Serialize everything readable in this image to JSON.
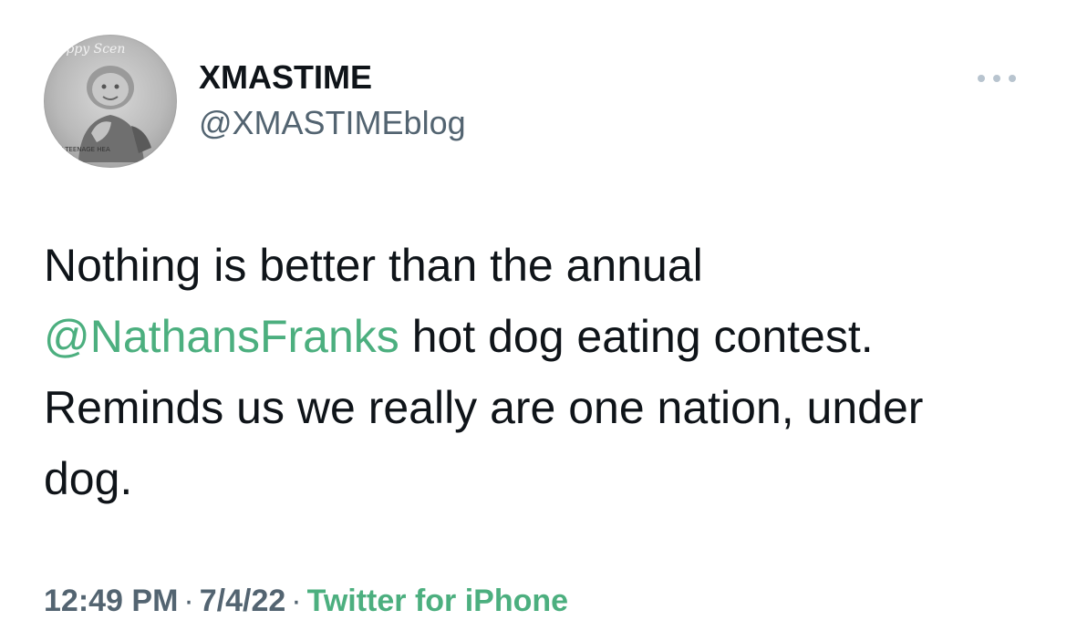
{
  "author": {
    "name": "XMASTIME",
    "handle": "@XMASTIMEblog",
    "avatar_text_top": "appy Scen",
    "avatar_text_bottom": "E MY TEENAGE HEA"
  },
  "tweet": {
    "text_before": "Nothing is better than the annual ",
    "mention": "@NathansFranks",
    "text_after": " hot dog eating contest. Reminds us we really are one nation, under dog."
  },
  "meta": {
    "time": "12:49 PM",
    "separator": "·",
    "date": "7/4/22",
    "source": "Twitter for iPhone"
  },
  "icons": {
    "more": "more-horizontal-icon"
  },
  "colors": {
    "text": "#0f1419",
    "secondary": "#536471",
    "link": "#4caf7f"
  }
}
